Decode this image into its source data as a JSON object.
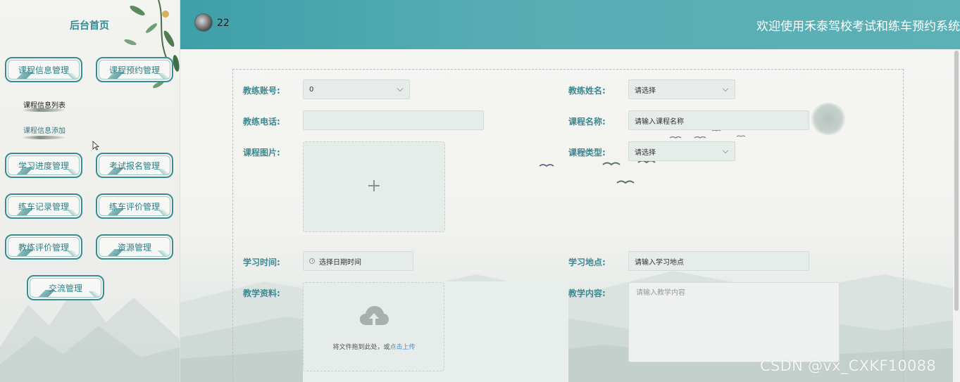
{
  "sidebar": {
    "title": "后台首页",
    "menu": [
      {
        "label": "课程信息管理"
      },
      {
        "label": "课程预约管理"
      },
      {
        "label": "学习进度管理"
      },
      {
        "label": "考试报名管理"
      },
      {
        "label": "练车记录管理"
      },
      {
        "label": "练车评价管理"
      },
      {
        "label": "教练评价管理"
      },
      {
        "label": "资源管理"
      },
      {
        "label": "交流管理"
      }
    ],
    "submenu": [
      "课程信息列表",
      "课程信息添加"
    ]
  },
  "header": {
    "username": "22",
    "welcome": "欢迎使用禾泰驾校考试和练车预约系统"
  },
  "form": {
    "coach_account": {
      "label": "教练账号:",
      "value": "0"
    },
    "coach_name": {
      "label": "教练姓名:",
      "placeholder": "请选择"
    },
    "coach_phone": {
      "label": "教练电话:",
      "value": ""
    },
    "course_name": {
      "label": "课程名称:",
      "placeholder": "请输入课程名称"
    },
    "course_image": {
      "label": "课程图片:"
    },
    "course_type": {
      "label": "课程类型:",
      "placeholder": "请选择"
    },
    "study_time": {
      "label": "学习时间:",
      "placeholder": "选择日期时间"
    },
    "study_location": {
      "label": "学习地点:",
      "placeholder": "请输入学习地点"
    },
    "teaching_material": {
      "label": "教学资料:",
      "drop_text": "将文件拖到此处，或",
      "drop_link": "点击上传"
    },
    "teaching_content": {
      "label": "教学内容:",
      "placeholder": "请输入教学内容"
    }
  },
  "watermark": "CSDN @vx_CXKF10088",
  "colors": {
    "accent": "#3b8890",
    "header": "#56adb3",
    "link": "#3d8ed9"
  }
}
